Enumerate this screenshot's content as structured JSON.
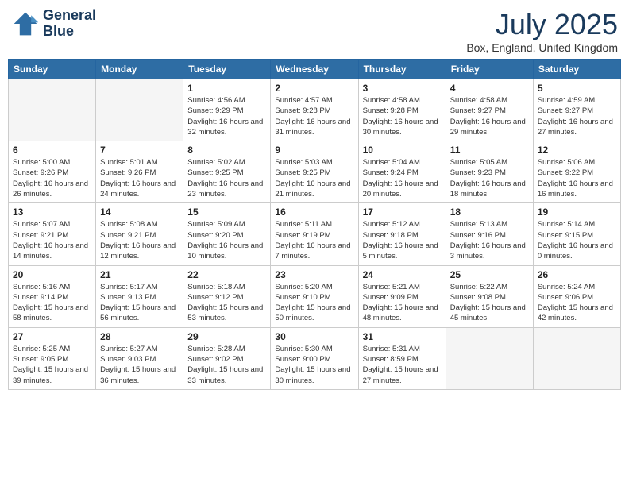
{
  "header": {
    "logo_line1": "General",
    "logo_line2": "Blue",
    "main_title": "July 2025",
    "subtitle": "Box, England, United Kingdom"
  },
  "days_of_week": [
    "Sunday",
    "Monday",
    "Tuesday",
    "Wednesday",
    "Thursday",
    "Friday",
    "Saturday"
  ],
  "weeks": [
    [
      {
        "day": "",
        "empty": true
      },
      {
        "day": "",
        "empty": true
      },
      {
        "day": "1",
        "sunrise": "4:56 AM",
        "sunset": "9:29 PM",
        "daylight": "16 hours and 32 minutes."
      },
      {
        "day": "2",
        "sunrise": "4:57 AM",
        "sunset": "9:28 PM",
        "daylight": "16 hours and 31 minutes."
      },
      {
        "day": "3",
        "sunrise": "4:58 AM",
        "sunset": "9:28 PM",
        "daylight": "16 hours and 30 minutes."
      },
      {
        "day": "4",
        "sunrise": "4:58 AM",
        "sunset": "9:27 PM",
        "daylight": "16 hours and 29 minutes."
      },
      {
        "day": "5",
        "sunrise": "4:59 AM",
        "sunset": "9:27 PM",
        "daylight": "16 hours and 27 minutes."
      }
    ],
    [
      {
        "day": "6",
        "sunrise": "5:00 AM",
        "sunset": "9:26 PM",
        "daylight": "16 hours and 26 minutes."
      },
      {
        "day": "7",
        "sunrise": "5:01 AM",
        "sunset": "9:26 PM",
        "daylight": "16 hours and 24 minutes."
      },
      {
        "day": "8",
        "sunrise": "5:02 AM",
        "sunset": "9:25 PM",
        "daylight": "16 hours and 23 minutes."
      },
      {
        "day": "9",
        "sunrise": "5:03 AM",
        "sunset": "9:25 PM",
        "daylight": "16 hours and 21 minutes."
      },
      {
        "day": "10",
        "sunrise": "5:04 AM",
        "sunset": "9:24 PM",
        "daylight": "16 hours and 20 minutes."
      },
      {
        "day": "11",
        "sunrise": "5:05 AM",
        "sunset": "9:23 PM",
        "daylight": "16 hours and 18 minutes."
      },
      {
        "day": "12",
        "sunrise": "5:06 AM",
        "sunset": "9:22 PM",
        "daylight": "16 hours and 16 minutes."
      }
    ],
    [
      {
        "day": "13",
        "sunrise": "5:07 AM",
        "sunset": "9:21 PM",
        "daylight": "16 hours and 14 minutes."
      },
      {
        "day": "14",
        "sunrise": "5:08 AM",
        "sunset": "9:21 PM",
        "daylight": "16 hours and 12 minutes."
      },
      {
        "day": "15",
        "sunrise": "5:09 AM",
        "sunset": "9:20 PM",
        "daylight": "16 hours and 10 minutes."
      },
      {
        "day": "16",
        "sunrise": "5:11 AM",
        "sunset": "9:19 PM",
        "daylight": "16 hours and 7 minutes."
      },
      {
        "day": "17",
        "sunrise": "5:12 AM",
        "sunset": "9:18 PM",
        "daylight": "16 hours and 5 minutes."
      },
      {
        "day": "18",
        "sunrise": "5:13 AM",
        "sunset": "9:16 PM",
        "daylight": "16 hours and 3 minutes."
      },
      {
        "day": "19",
        "sunrise": "5:14 AM",
        "sunset": "9:15 PM",
        "daylight": "16 hours and 0 minutes."
      }
    ],
    [
      {
        "day": "20",
        "sunrise": "5:16 AM",
        "sunset": "9:14 PM",
        "daylight": "15 hours and 58 minutes."
      },
      {
        "day": "21",
        "sunrise": "5:17 AM",
        "sunset": "9:13 PM",
        "daylight": "15 hours and 56 minutes."
      },
      {
        "day": "22",
        "sunrise": "5:18 AM",
        "sunset": "9:12 PM",
        "daylight": "15 hours and 53 minutes."
      },
      {
        "day": "23",
        "sunrise": "5:20 AM",
        "sunset": "9:10 PM",
        "daylight": "15 hours and 50 minutes."
      },
      {
        "day": "24",
        "sunrise": "5:21 AM",
        "sunset": "9:09 PM",
        "daylight": "15 hours and 48 minutes."
      },
      {
        "day": "25",
        "sunrise": "5:22 AM",
        "sunset": "9:08 PM",
        "daylight": "15 hours and 45 minutes."
      },
      {
        "day": "26",
        "sunrise": "5:24 AM",
        "sunset": "9:06 PM",
        "daylight": "15 hours and 42 minutes."
      }
    ],
    [
      {
        "day": "27",
        "sunrise": "5:25 AM",
        "sunset": "9:05 PM",
        "daylight": "15 hours and 39 minutes."
      },
      {
        "day": "28",
        "sunrise": "5:27 AM",
        "sunset": "9:03 PM",
        "daylight": "15 hours and 36 minutes."
      },
      {
        "day": "29",
        "sunrise": "5:28 AM",
        "sunset": "9:02 PM",
        "daylight": "15 hours and 33 minutes."
      },
      {
        "day": "30",
        "sunrise": "5:30 AM",
        "sunset": "9:00 PM",
        "daylight": "15 hours and 30 minutes."
      },
      {
        "day": "31",
        "sunrise": "5:31 AM",
        "sunset": "8:59 PM",
        "daylight": "15 hours and 27 minutes."
      },
      {
        "day": "",
        "empty": true
      },
      {
        "day": "",
        "empty": true
      }
    ]
  ]
}
